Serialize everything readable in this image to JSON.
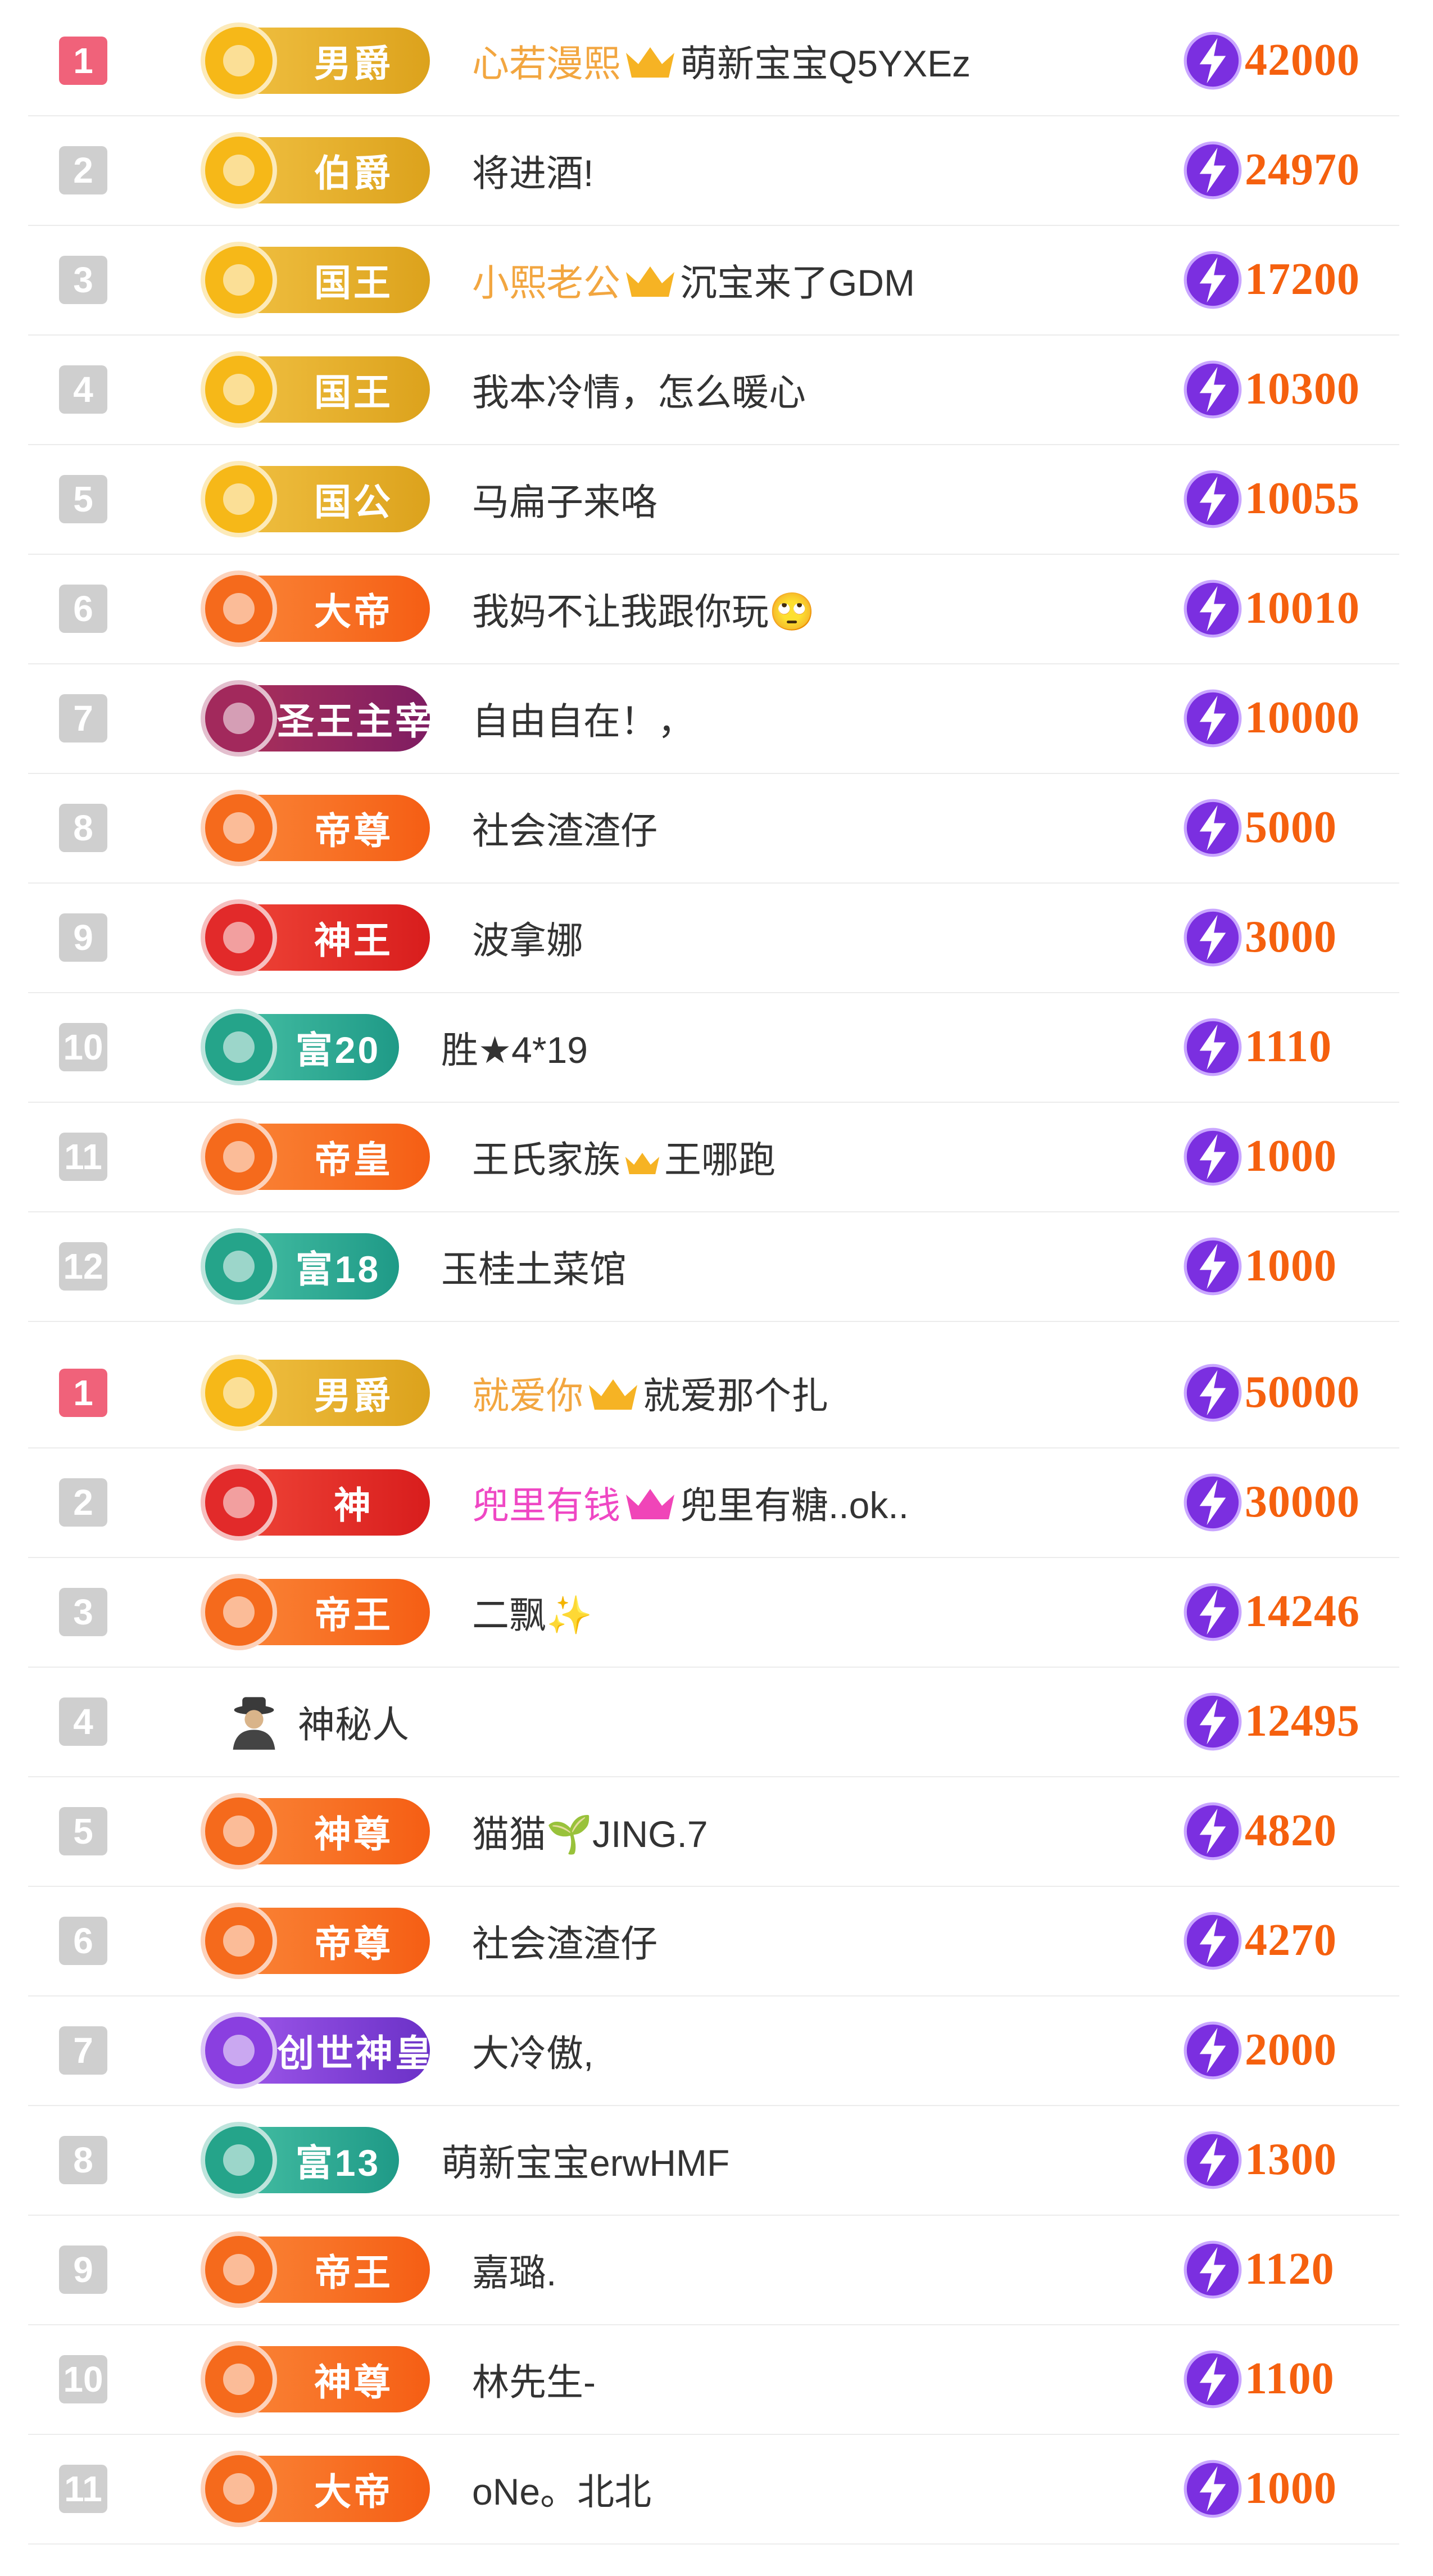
{
  "colors": {
    "score": "#f5600e",
    "rank_top": "#f0627a",
    "rank_default": "#cfcfcf",
    "bolt": "#7b2fe0"
  },
  "sections": [
    {
      "rows": [
        {
          "rank": "1",
          "badge": {
            "style": "gold",
            "label": "男爵"
          },
          "name_pre": "",
          "name_hl": "心若漫熙",
          "hl_color": "gold",
          "crown": "gold-crown-icon",
          "name_post": "萌新宝宝Q5YXEz",
          "score": "42000"
        },
        {
          "rank": "2",
          "badge": {
            "style": "gold",
            "label": "伯爵"
          },
          "name_pre": "将进酒!",
          "name_hl": "",
          "hl_color": "",
          "crown": "",
          "name_post": "",
          "score": "24970"
        },
        {
          "rank": "3",
          "badge": {
            "style": "gold",
            "label": "国王"
          },
          "name_pre": "",
          "name_hl": "小熙老公",
          "hl_color": "gold",
          "crown": "gold-crown-icon",
          "name_post": "沉宝来了GDM",
          "score": "17200"
        },
        {
          "rank": "4",
          "badge": {
            "style": "gold",
            "label": "国王"
          },
          "name_pre": "我本冷情，怎么暖心",
          "name_hl": "",
          "hl_color": "",
          "crown": "",
          "name_post": "",
          "score": "10300"
        },
        {
          "rank": "5",
          "badge": {
            "style": "gold",
            "label": "国公"
          },
          "name_pre": "马扁子来咯",
          "name_hl": "",
          "hl_color": "",
          "crown": "",
          "name_post": "",
          "score": "10055"
        },
        {
          "rank": "6",
          "badge": {
            "style": "orange",
            "label": "大帝"
          },
          "name_pre": "我妈不让我跟你玩🙄",
          "name_hl": "",
          "hl_color": "",
          "crown": "",
          "name_post": "",
          "score": "10010"
        },
        {
          "rank": "7",
          "badge": {
            "style": "magenta",
            "label": "圣王主宰"
          },
          "name_pre": "自由自在！，",
          "name_hl": "",
          "hl_color": "",
          "crown": "",
          "name_post": "",
          "score": "10000"
        },
        {
          "rank": "8",
          "badge": {
            "style": "orange",
            "label": "帝尊"
          },
          "name_pre": "社会渣渣仔",
          "name_hl": "",
          "hl_color": "",
          "crown": "",
          "name_post": "",
          "score": "5000"
        },
        {
          "rank": "9",
          "badge": {
            "style": "red",
            "label": "神王"
          },
          "name_pre": "波拿娜",
          "name_hl": "",
          "hl_color": "",
          "crown": "",
          "name_post": "",
          "score": "3000"
        },
        {
          "rank": "10",
          "badge": {
            "style": "teal",
            "label": "富20"
          },
          "name_pre": "胜★4*19",
          "name_hl": "",
          "hl_color": "",
          "crown": "",
          "name_post": "",
          "score": "1110"
        },
        {
          "rank": "11",
          "badge": {
            "style": "orange",
            "label": "帝皇"
          },
          "name_pre": "王氏家族",
          "name_hl": "",
          "hl_color": "",
          "crown": "small-crown-icon",
          "name_post": "王哪跑",
          "score": "1000"
        },
        {
          "rank": "12",
          "badge": {
            "style": "teal",
            "label": "富18"
          },
          "name_pre": "玉桂土菜馆",
          "name_hl": "",
          "hl_color": "",
          "crown": "",
          "name_post": "",
          "score": "1000"
        }
      ]
    },
    {
      "rows": [
        {
          "rank": "1",
          "badge": {
            "style": "gold",
            "label": "男爵"
          },
          "name_pre": "",
          "name_hl": "就爱你",
          "hl_color": "gold",
          "crown": "gold-crown-icon",
          "name_post": "就爱那个扎",
          "score": "50000"
        },
        {
          "rank": "2",
          "badge": {
            "style": "red",
            "label": "神"
          },
          "name_pre": "",
          "name_hl": "兜里有钱",
          "hl_color": "pink",
          "crown": "pink-crown-icon",
          "name_post": "兜里有糖..ok..",
          "score": "30000"
        },
        {
          "rank": "3",
          "badge": {
            "style": "orange",
            "label": "帝王"
          },
          "name_pre": "二飘✨",
          "name_hl": "",
          "hl_color": "",
          "crown": "",
          "name_post": "",
          "score": "14246"
        },
        {
          "rank": "4",
          "badge": null,
          "mystery": "mystery-person-icon",
          "name_pre": "神秘人",
          "name_hl": "",
          "hl_color": "",
          "crown": "",
          "name_post": "",
          "score": "12495"
        },
        {
          "rank": "5",
          "badge": {
            "style": "orange",
            "label": "神尊"
          },
          "name_pre": "猫猫🌱JING.7",
          "name_hl": "",
          "hl_color": "",
          "crown": "",
          "name_post": "",
          "score": "4820"
        },
        {
          "rank": "6",
          "badge": {
            "style": "orange",
            "label": "帝尊"
          },
          "name_pre": "社会渣渣仔",
          "name_hl": "",
          "hl_color": "",
          "crown": "",
          "name_post": "",
          "score": "4270"
        },
        {
          "rank": "7",
          "badge": {
            "style": "purple",
            "label": "创世神皇"
          },
          "name_pre": "大冷傲,",
          "name_hl": "",
          "hl_color": "",
          "crown": "",
          "name_post": "",
          "score": "2000"
        },
        {
          "rank": "8",
          "badge": {
            "style": "teal",
            "label": "富13"
          },
          "name_pre": "萌新宝宝erwHMF",
          "name_hl": "",
          "hl_color": "",
          "crown": "",
          "name_post": "",
          "score": "1300"
        },
        {
          "rank": "9",
          "badge": {
            "style": "orange",
            "label": "帝王"
          },
          "name_pre": "嘉璐.",
          "name_hl": "",
          "hl_color": "",
          "crown": "",
          "name_post": "",
          "score": "1120"
        },
        {
          "rank": "10",
          "badge": {
            "style": "orange",
            "label": "神尊"
          },
          "name_pre": "林先生-",
          "name_hl": "",
          "hl_color": "",
          "crown": "",
          "name_post": "",
          "score": "1100"
        },
        {
          "rank": "11",
          "badge": {
            "style": "orange",
            "label": "大帝"
          },
          "name_pre": "oNe。北北",
          "name_hl": "",
          "hl_color": "",
          "crown": "",
          "name_post": "",
          "score": "1000"
        }
      ]
    }
  ]
}
